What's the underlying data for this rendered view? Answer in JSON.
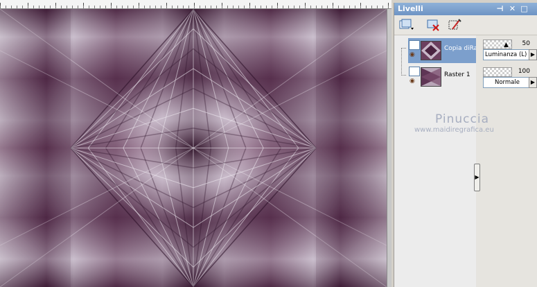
{
  "panel": {
    "title": "Livelli",
    "title_buttons": {
      "pin": "⊣",
      "close": "✕",
      "maximize": "□"
    }
  },
  "toolbar": {
    "icons": [
      "new-layer-icon",
      "delete-layer-icon",
      "edit-selection-icon"
    ]
  },
  "layers": [
    {
      "name": "Copia diRaster 1",
      "selected": true,
      "opacity": "50",
      "blend_mode": "Luminanza (L)"
    },
    {
      "name": "Raster 1",
      "selected": false,
      "opacity": "100",
      "blend_mode": "Normale"
    }
  ],
  "watermark": {
    "name": "Pinuccia",
    "url": "www.maidiregrafica.eu"
  },
  "colors": {
    "image_dark": "#3a1a33",
    "image_light": "#e6e0ea",
    "panel_title": "#7ea2cf",
    "selected_row": "#7c9fcc"
  }
}
